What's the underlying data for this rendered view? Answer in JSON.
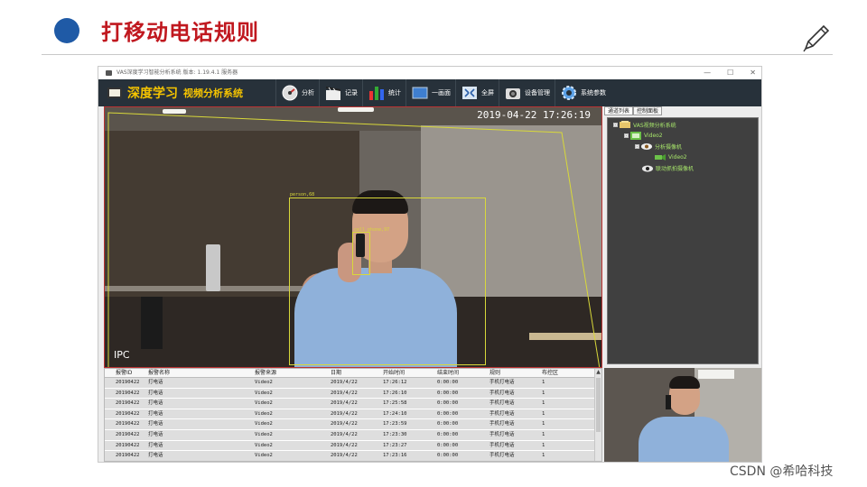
{
  "slide": {
    "title": "打移动电话规则",
    "credit": "CSDN @希哈科技"
  },
  "window": {
    "title": "VAS深度学习智能分析系统 版本: 1.19.4.1 服务器",
    "controls": [
      "—",
      "☐",
      "✕"
    ]
  },
  "toolbar": {
    "brand_main": "深度学习",
    "brand_sub": "视频分析系统",
    "buttons": [
      {
        "label": "分析",
        "icon": "gauge-icon"
      },
      {
        "label": "记录",
        "icon": "clapper-icon"
      },
      {
        "label": "统计",
        "icon": "bar-chart-icon"
      },
      {
        "label": "一画面",
        "icon": "single-screen-icon"
      },
      {
        "label": "全屏",
        "icon": "fullscreen-icon"
      },
      {
        "label": "设备管理",
        "icon": "camera-icon"
      },
      {
        "label": "系统参数",
        "icon": "gear-icon"
      }
    ]
  },
  "video": {
    "timestamp": "2019-04-22 17:26:19",
    "source_label": "IPC",
    "detections": [
      {
        "label": "person,68"
      },
      {
        "label": "cell phone,97"
      }
    ],
    "overlay_color": "#d8d83a"
  },
  "side_panel": {
    "tabs": [
      "通道列表",
      "控制面板"
    ],
    "tree": [
      {
        "label": "VAS视频分析系统",
        "level": 0,
        "icon": "server-icon"
      },
      {
        "label": "Video2",
        "level": 1,
        "icon": "channel-icon"
      },
      {
        "label": "分析摄像机",
        "level": 2,
        "icon": "eye-icon"
      },
      {
        "label": "Video2",
        "level": 3,
        "icon": "camera-green-icon"
      },
      {
        "label": "联动抓拍摄像机",
        "level": 2,
        "icon": "camera-dark-icon"
      }
    ]
  },
  "alarm_table": {
    "headers": [
      "报警ID",
      "报警名称",
      "报警来源",
      "日期",
      "开始时间",
      "结束时间",
      "规则",
      "布控区"
    ],
    "rows": [
      [
        "20190422",
        "打电话",
        "Video2",
        "2019/4/22",
        "17:26:12",
        "0:00:00",
        "手机打电话",
        "1"
      ],
      [
        "20190422",
        "打电话",
        "Video2",
        "2019/4/22",
        "17:26:10",
        "0:00:00",
        "手机打电话",
        "1"
      ],
      [
        "20190422",
        "打电话",
        "Video2",
        "2019/4/22",
        "17:25:58",
        "0:00:00",
        "手机打电话",
        "1"
      ],
      [
        "20190422",
        "打电话",
        "Video2",
        "2019/4/22",
        "17:24:10",
        "0:00:00",
        "手机打电话",
        "1"
      ],
      [
        "20190422",
        "打电话",
        "Video2",
        "2019/4/22",
        "17:23:59",
        "0:00:00",
        "手机打电话",
        "1"
      ],
      [
        "20190422",
        "打电话",
        "Video2",
        "2019/4/22",
        "17:23:30",
        "0:00:00",
        "手机打电话",
        "1"
      ],
      [
        "20190422",
        "打电话",
        "Video2",
        "2019/4/22",
        "17:23:27",
        "0:00:00",
        "手机打电话",
        "1"
      ],
      [
        "20190422",
        "打电话",
        "Video2",
        "2019/4/22",
        "17:23:16",
        "0:00:00",
        "手机打电话",
        "1"
      ]
    ]
  }
}
